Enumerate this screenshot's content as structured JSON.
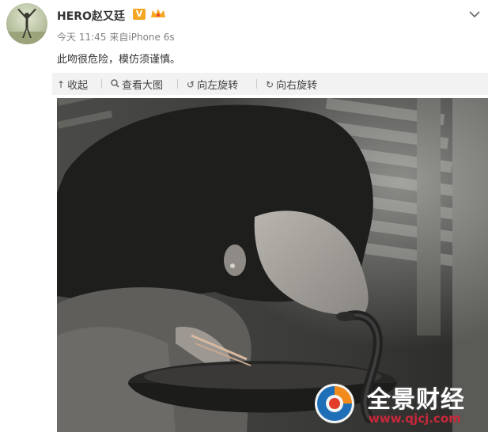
{
  "post": {
    "username": "HERO赵又廷",
    "verified_badge": "V",
    "crown_icon": "crown-icon",
    "time": "今天 11:45",
    "source": "来自iPhone 6s",
    "text": "此吻很危险，模仿须谨慎。"
  },
  "toolbar": {
    "collapse": "收起",
    "view_large": "查看大图",
    "rotate_left": "向左旋转",
    "rotate_right": "向右旋转"
  },
  "watermark": {
    "brand": "全景财经",
    "url": "www.qjcj.com"
  },
  "colors": {
    "accent": "#f5a623",
    "meta": "#808080",
    "toolbar_bg": "#f2f2f2",
    "watermark_red": "#c8283a"
  }
}
